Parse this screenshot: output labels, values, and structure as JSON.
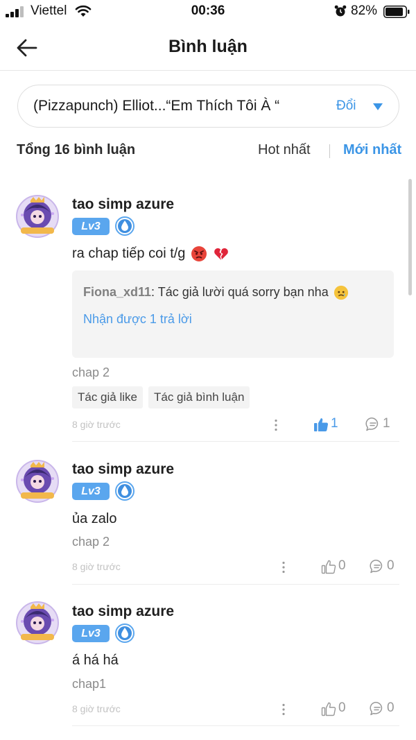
{
  "status_bar": {
    "carrier": "Viettel",
    "time": "00:36",
    "battery": "82%"
  },
  "header": {
    "title": "Bình luận",
    "back_icon": "arrow-left-icon"
  },
  "chapter_selector": {
    "title": "(Pizzapunch) Elliot...“Em Thích Tôi À “",
    "change_label": "Đổi"
  },
  "summary": {
    "total": "Tổng 16 bình luận",
    "sort_hot": "Hot nhất",
    "sort_new": "Mới nhất",
    "active_sort": "Mới nhất"
  },
  "colors": {
    "accent": "#3b95e6",
    "badge": "#5aa6ee",
    "reply_bg": "#f4f4f4"
  },
  "comments": [
    {
      "username": "tao simp azure",
      "level": "Lv3",
      "text": "ra chap tiếp coi t/g",
      "reply": {
        "user": "Fiona_xd11",
        "text": ": Tác giả lười quá sorry bạn nha",
        "count_label": "Nhận được 1 trả lời"
      },
      "chapter": "chap 2",
      "tags": [
        "Tác giả like",
        "Tác giả bình luận"
      ],
      "time": "8 giờ trước",
      "likes": "1",
      "liked": true,
      "replies": "1"
    },
    {
      "username": "tao simp azure",
      "level": "Lv3",
      "text": "ủa zalo",
      "chapter": "chap 2",
      "time": "8 giờ trước",
      "likes": "0",
      "liked": false,
      "replies": "0"
    },
    {
      "username": "tao simp azure",
      "level": "Lv3",
      "text": "á há há",
      "chapter": "chap1",
      "time": "8 giờ trước",
      "likes": "0",
      "liked": false,
      "replies": "0"
    }
  ]
}
